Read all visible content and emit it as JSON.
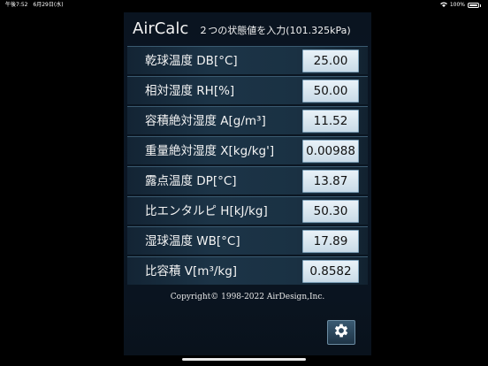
{
  "status_bar": {
    "time": "午後7:52",
    "date": "6月29日(水)",
    "battery": "100%"
  },
  "header": {
    "app_name": "AirCalc",
    "subtitle": "２つの状態値を入力(101.325kPa)"
  },
  "rows": [
    {
      "label": "乾球温度 DB[°C]",
      "value": "25.00"
    },
    {
      "label": "相対湿度 RH[%]",
      "value": "50.00"
    },
    {
      "label": "容積絶対湿度 A[g/m³]",
      "value": "11.52"
    },
    {
      "label": "重量絶対湿度 X[kg/kg']",
      "value": "0.00988"
    },
    {
      "label": "露点温度 DP[°C]",
      "value": "13.87"
    },
    {
      "label": "比エンタルピ H[kJ/kg]",
      "value": "50.30"
    },
    {
      "label": "湿球温度 WB[°C]",
      "value": "17.89"
    },
    {
      "label": "比容積 V[m³/kg]",
      "value": "0.8582"
    }
  ],
  "footer": {
    "copyright": "Copyright© 1998-2022 AirDesign,Inc."
  },
  "icons": {
    "settings": "gear-icon"
  }
}
